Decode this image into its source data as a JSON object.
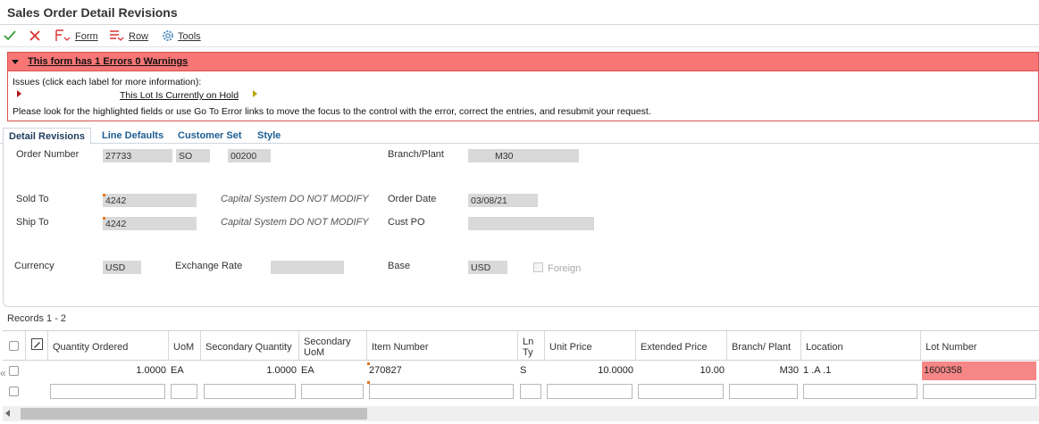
{
  "window": {
    "title": "Sales Order Detail Revisions"
  },
  "toolbar": {
    "form_label": "Form",
    "row_label": "Row",
    "tools_label": "Tools"
  },
  "errors": {
    "header": "This form has 1 Errors 0 Warnings",
    "issues_label": "Issues (click each label for more information):",
    "issue_link": "This Lot Is Currently on Hold",
    "instructions": "Please look for the highlighted fields or use Go To Error links to move the focus to the control with the error, correct the entries, and resubmit your request."
  },
  "tabs": [
    "Detail Revisions",
    "Line Defaults",
    "Customer Set",
    "Style"
  ],
  "header": {
    "order_number_label": "Order Number",
    "order_number": "27733",
    "order_type": "SO",
    "order_company": "00200",
    "branch_plant_label": "Branch/Plant",
    "branch_plant": "M30",
    "sold_to_label": "Sold To",
    "sold_to": "4242",
    "sold_to_name": "Capital System DO NOT MODIFY",
    "order_date_label": "Order Date",
    "order_date": "03/08/21",
    "ship_to_label": "Ship To",
    "ship_to": "4242",
    "ship_to_name": "Capital System DO NOT MODIFY",
    "cust_po_label": "Cust PO",
    "cust_po": "",
    "currency_label": "Currency",
    "currency": "USD",
    "exchange_rate_label": "Exchange Rate",
    "exchange_rate": "",
    "base_label": "Base",
    "base": "USD",
    "foreign_label": "Foreign"
  },
  "grid": {
    "records_label": "Records 1 - 2",
    "columns": {
      "qty_ordered": "Quantity Ordered",
      "uom": "UoM",
      "secondary_qty": "Secondary Quantity",
      "secondary_uom": "Secondary UoM",
      "item_number": "Item Number",
      "ln_ty": "Ln Ty",
      "unit_price": "Unit Price",
      "extended_price": "Extended Price",
      "branch_plant": "Branch/ Plant",
      "location": "Location",
      "lot_number": "Lot Number"
    },
    "rows": [
      {
        "qty_ordered": "1.0000",
        "uom": "EA",
        "secondary_qty": "1.0000",
        "secondary_uom": "EA",
        "item_number": "270827",
        "ln_ty": "S",
        "unit_price": "10.0000",
        "extended_price": "10.00",
        "branch_plant": "M30",
        "location": "1 .A  .1",
        "lot_number": "1600358"
      }
    ]
  },
  "colors": {
    "error_bg": "#f87676",
    "error_cell": "#f78686",
    "tab_text": "#1d5e93",
    "accept": "#3a9b3a",
    "cancel": "#d93333"
  }
}
